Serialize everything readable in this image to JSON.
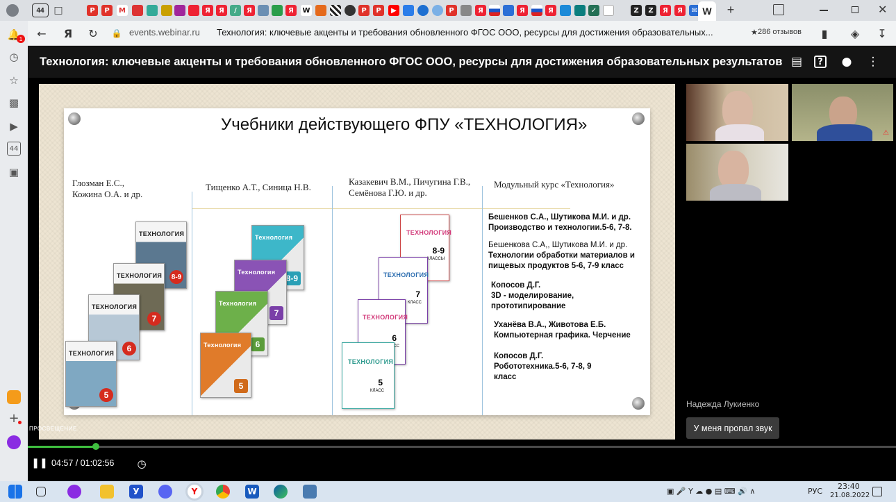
{
  "browser": {
    "tab_count_badge": "44",
    "active_tab_letter": "W",
    "domain": "events.webinar.ru",
    "page_title": "Технология: ключевые акценты и требования обновленного ФГОС ООО, ресурсы для достижения образовательных...",
    "reviews": "286 отзывов",
    "sidebar_badge": "1",
    "sidebar_tab_count": "44"
  },
  "webinar": {
    "title": "Технология: ключевые акценты и требования обновленного ФГОС ООО, ресурсы для достижения образовательных результатов",
    "icons": [
      "chat-icon",
      "help-icon",
      "person-icon",
      "more-icon"
    ]
  },
  "slide": {
    "title": "Учебники действующего ФПУ «ТЕХНОЛОГИЯ»",
    "columns": [
      {
        "authors": "Глозман Е.С., Кожина О.А. и др."
      },
      {
        "authors": "Тищенко А.Т., Синица Н.В."
      },
      {
        "authors": "Казакевич В.М., Пичугина Г.В., Семёнова Г.Ю. и др."
      },
      {
        "authors": "Модульный курс «Технология»"
      }
    ],
    "book_title": "ТЕХНОЛОГИЯ",
    "book_title_alt": "Технология",
    "grades_col1": [
      "8-9",
      "7",
      "6",
      "5"
    ],
    "grades_col2": [
      "8-9",
      "7",
      "6",
      "5"
    ],
    "grades_col3": [
      "8-9",
      "7",
      "6",
      "5"
    ],
    "class_label": "КЛАСС",
    "classes_label": "КЛАССЫ",
    "modules": [
      {
        "authors": "Бешенков С.А., Шутикова М.И. и др.",
        "title": "Производство и технологии.5-6, 7-8."
      },
      {
        "authors": "Бешенкова С.А,, Шутикова М.И. и др.",
        "title": "Технологии обработки материалов и пищевых продуктов 5-6, 7-9 класс"
      },
      {
        "authors": "Копосов Д.Г.",
        "title": "3D - моделирование, прототипирование"
      },
      {
        "authors": "Уханёва В.А., Животова Е.Б.",
        "title": "Компьютерная графика. Черчение"
      },
      {
        "authors": "Копосов Д.Г.",
        "title": "Робототехника.5-6, 7-8, 9 класс"
      }
    ],
    "publisher_logo": "ПРОСВЕЩЕНИЕ"
  },
  "participants": {
    "speaker_name": "Надежда Лукиенко",
    "chat_message": "У меня пропал звук"
  },
  "player": {
    "current_time": "04:57",
    "duration": "01:02:56",
    "time_display": "04:57 / 01:02:56",
    "progress_fraction": 0.0787
  },
  "taskbar": {
    "language": "РУС",
    "time": "23:40",
    "date": "21.08.2022"
  },
  "colors": {
    "accent_green": "#3fbf3f",
    "dark_header": "#141414",
    "grade_red": "#d52b1e"
  }
}
